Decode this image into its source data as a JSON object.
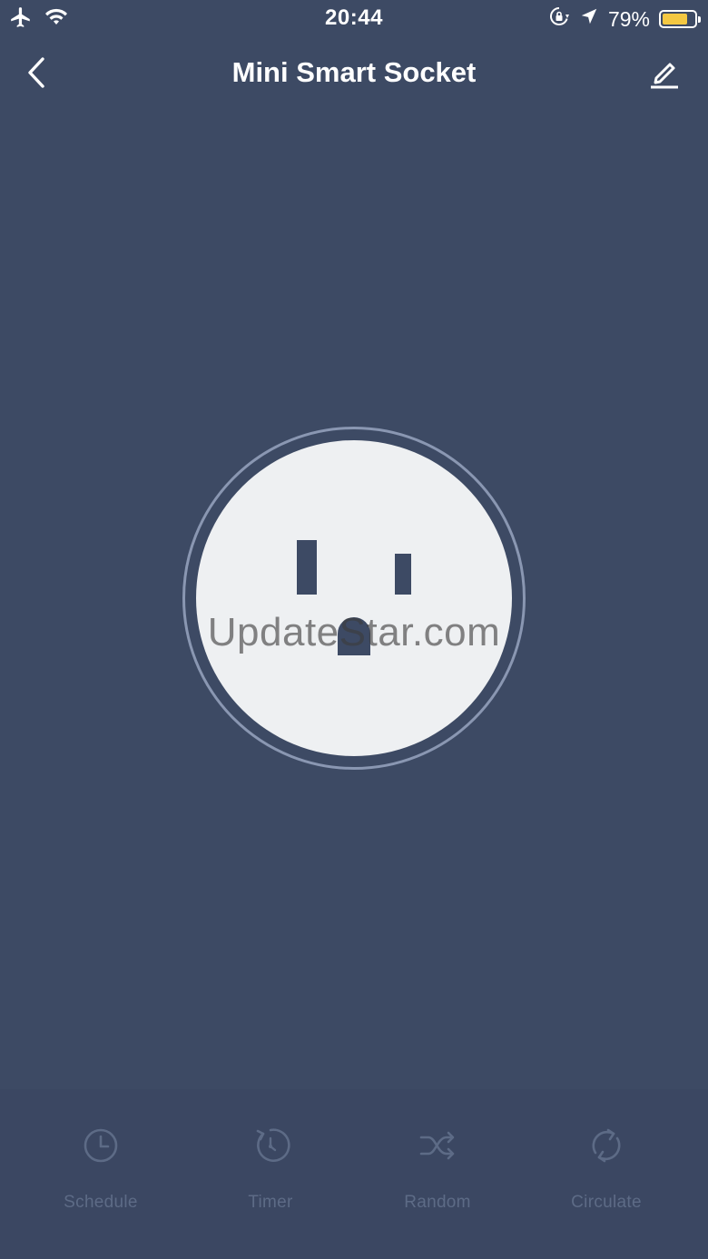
{
  "status_bar": {
    "time": "20:44",
    "battery_percent": "79%",
    "battery_level": 0.79,
    "battery_color": "#f4c842",
    "icons": [
      "airplane-icon",
      "wifi-icon",
      "orientation-lock-icon",
      "location-arrow-icon",
      "battery-icon"
    ]
  },
  "nav": {
    "title": "Mini Smart Socket",
    "back_icon": "chevron-left-icon",
    "edit_icon": "pencil-icon"
  },
  "socket": {
    "state": "off",
    "face_color": "#eef0f2",
    "background_color": "#3d4a64"
  },
  "watermark": {
    "text": "UpdateStar.com"
  },
  "bottom_tabs": [
    {
      "label": "Schedule",
      "icon": "clock-icon"
    },
    {
      "label": "Timer",
      "icon": "timer-icon"
    },
    {
      "label": "Random",
      "icon": "shuffle-icon"
    },
    {
      "label": "Circulate",
      "icon": "cycle-icon"
    }
  ]
}
